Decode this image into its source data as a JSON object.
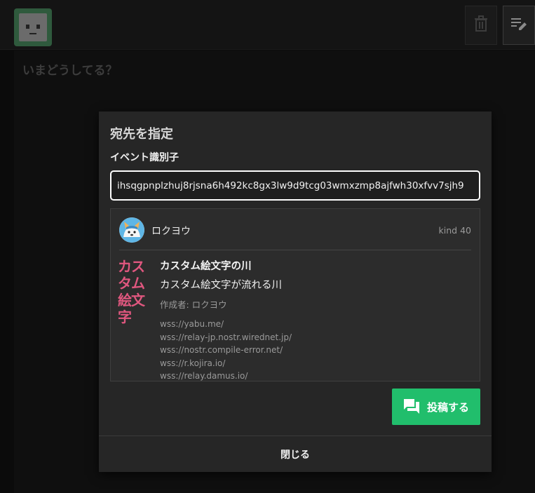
{
  "compose": {
    "placeholder": "いまどうしてる？"
  },
  "toolbar": {
    "delete_icon": "trash-icon",
    "edit_icon": "edit-note-icon"
  },
  "modal": {
    "title": "宛先を指定",
    "field_label": "イベント識別子",
    "event_id_value": "ihsqgpnplzhuj8rjsna6h492kc8gx3lw9d9tcg03wmxzmp8ajfwh30xfvv7sjh9",
    "card": {
      "author_name": "ロクヨウ",
      "kind": "kind 40",
      "emoji_logo_line1": "カスタム",
      "emoji_logo_line2": "絵文字",
      "channel_name": "カスタム絵文字の川",
      "channel_about": "カスタム絵文字が流れる川",
      "author_line": "作成者: ロクヨウ",
      "relays": [
        "wss://yabu.me/",
        "wss://relay-jp.nostr.wirednet.jp/",
        "wss://nostr.compile-error.net/",
        "wss://r.kojira.io/",
        "wss://relay.damus.io/"
      ]
    },
    "post_label": "投稿する",
    "close_label": "閉じる"
  },
  "colors": {
    "accent": "#21be6c",
    "emoji_pink": "#e0577f"
  }
}
